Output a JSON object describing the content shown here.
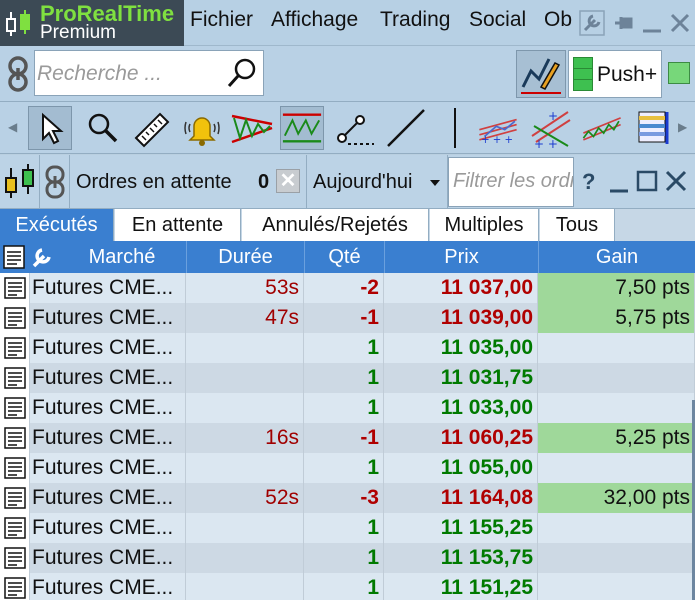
{
  "app": {
    "brand": "ProRealTime",
    "edition": "Premium"
  },
  "menu": [
    "Fichier",
    "Affichage",
    "Trading",
    "Social",
    "Ob"
  ],
  "search": {
    "placeholder": "Recherche ..."
  },
  "toolbar": {
    "push_label": "Push+"
  },
  "panel": {
    "title": "Ordres en attente",
    "count": "0",
    "period": "Aujourd'hui",
    "filter_placeholder": "Filtrer les ordres",
    "help": "?"
  },
  "tabs": [
    "Exécutés",
    "En attente",
    "Annulés/Rejetés",
    "Multiples",
    "Tous"
  ],
  "selected_tab": "Exécutés",
  "columns": [
    "Marché",
    "Durée",
    "Qté",
    "Prix",
    "Gain"
  ],
  "rows": [
    {
      "market": "Futures CME...",
      "duration": "53s",
      "qty": "-2",
      "price": "11 037,00",
      "gain": "7,50 pts"
    },
    {
      "market": "Futures CME...",
      "duration": "47s",
      "qty": "-1",
      "price": "11 039,00",
      "gain": "5,75 pts"
    },
    {
      "market": "Futures CME...",
      "duration": "",
      "qty": "1",
      "price": "11 035,00",
      "gain": ""
    },
    {
      "market": "Futures CME...",
      "duration": "",
      "qty": "1",
      "price": "11 031,75",
      "gain": ""
    },
    {
      "market": "Futures CME...",
      "duration": "",
      "qty": "1",
      "price": "11 033,00",
      "gain": ""
    },
    {
      "market": "Futures CME...",
      "duration": "16s",
      "qty": "-1",
      "price": "11 060,25",
      "gain": "5,25 pts"
    },
    {
      "market": "Futures CME...",
      "duration": "",
      "qty": "1",
      "price": "11 055,00",
      "gain": ""
    },
    {
      "market": "Futures CME...",
      "duration": "52s",
      "qty": "-3",
      "price": "11 164,08",
      "gain": "32,00 pts"
    },
    {
      "market": "Futures CME...",
      "duration": "",
      "qty": "1",
      "price": "11 155,25",
      "gain": ""
    },
    {
      "market": "Futures CME...",
      "duration": "",
      "qty": "1",
      "price": "11 153,75",
      "gain": ""
    },
    {
      "market": "Futures CME...",
      "duration": "",
      "qty": "1",
      "price": "11 151,25",
      "gain": ""
    }
  ],
  "colors": {
    "accent": "#3a7fd0",
    "brand_green": "#7fe040",
    "negative": "#b00000",
    "positive": "#007a00",
    "gain_bg": "#9fd89a"
  },
  "icons": {
    "logo": "candlestick-icon",
    "link": "chain-link-icon",
    "search": "magnifier-icon",
    "tools": [
      "cursor-icon",
      "zoom-icon",
      "ruler-icon",
      "alert-bell-icon",
      "triangle-pattern-icon",
      "zigzag-pattern-icon",
      "segment-icon",
      "line-icon",
      "fibonacci-icon",
      "arrows-pattern-icon",
      "trend-channel-icon",
      "color-table-icon"
    ]
  }
}
